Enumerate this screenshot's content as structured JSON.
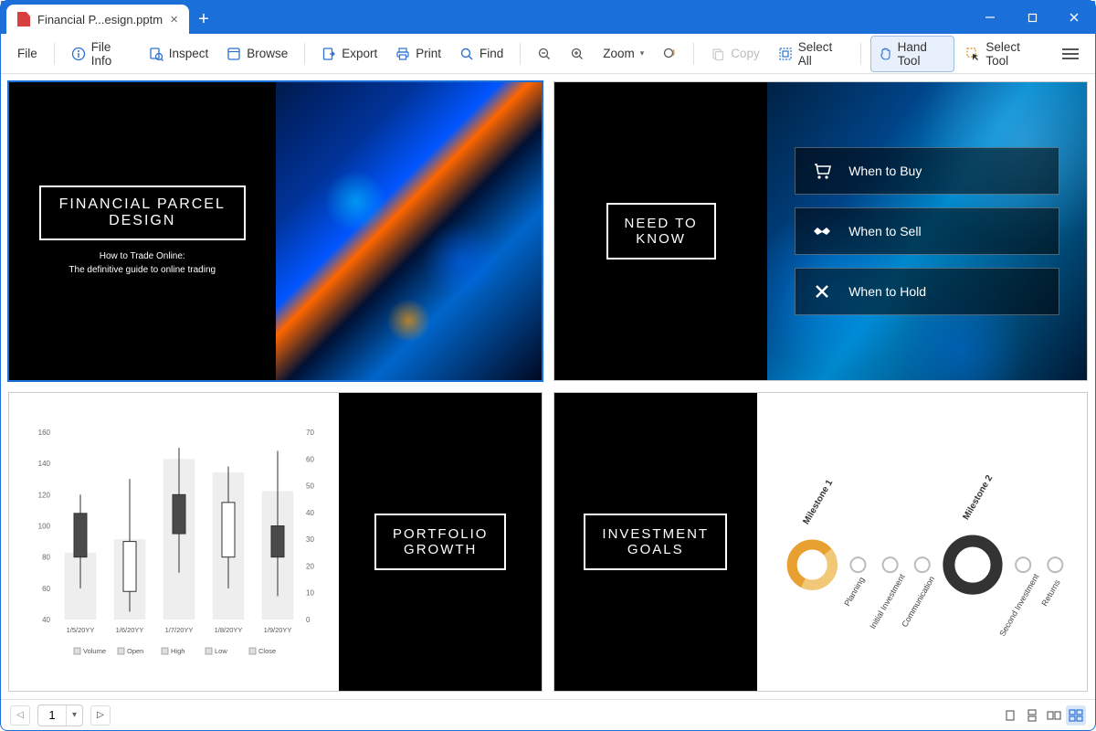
{
  "tab": {
    "title": "Financial P...esign.pptm"
  },
  "toolbar": {
    "file": "File",
    "fileinfo": "File Info",
    "inspect": "Inspect",
    "browse": "Browse",
    "export": "Export",
    "print": "Print",
    "find": "Find",
    "zoom": "Zoom",
    "copy": "Copy",
    "selectall": "Select All",
    "handtool": "Hand Tool",
    "selecttool": "Select Tool"
  },
  "slide1": {
    "title_l1": "FINANCIAL PARCEL",
    "title_l2": "DESIGN",
    "sub_l1": "How to Trade Online:",
    "sub_l2": "The definitive guide to online trading"
  },
  "slide2": {
    "title_l1": "NEED TO",
    "title_l2": "KNOW",
    "items": [
      {
        "label": "When to Buy"
      },
      {
        "label": "When to Sell"
      },
      {
        "label": "When to Hold"
      }
    ]
  },
  "slide3": {
    "title_l1": "PORTFOLIO",
    "title_l2": "GROWTH",
    "legend": [
      "Volume",
      "Open",
      "High",
      "Low",
      "Close"
    ]
  },
  "slide4": {
    "title_l1": "INVESTMENT",
    "title_l2": "GOALS",
    "milestones": [
      "Milestone 1",
      "Milestone 2"
    ],
    "steps": [
      "Planning",
      "Initial Investment",
      "Communication",
      "Second Investment",
      "Returns"
    ]
  },
  "status": {
    "page": "1"
  },
  "chart_data": {
    "type": "candlestick-with-volume",
    "title": "",
    "categories": [
      "1/5/20YY",
      "1/6/20YY",
      "1/7/20YY",
      "1/8/20YY",
      "1/9/20YY"
    ],
    "y_left": {
      "label": "",
      "range": [
        40,
        160
      ],
      "ticks": [
        40,
        60,
        80,
        100,
        120,
        140,
        160
      ]
    },
    "y_right": {
      "label": "",
      "range": [
        0,
        70
      ],
      "ticks": [
        0,
        10,
        20,
        30,
        40,
        50,
        60,
        70
      ]
    },
    "series": {
      "volume": [
        25,
        30,
        60,
        55,
        48
      ],
      "ohlc": [
        {
          "open": 80,
          "high": 120,
          "low": 60,
          "close": 108
        },
        {
          "open": 58,
          "high": 130,
          "low": 45,
          "close": 90
        },
        {
          "open": 95,
          "high": 150,
          "low": 70,
          "close": 120
        },
        {
          "open": 80,
          "high": 138,
          "low": 60,
          "close": 115
        },
        {
          "open": 80,
          "high": 148,
          "low": 55,
          "close": 100
        }
      ]
    },
    "legend": [
      "Volume",
      "Open",
      "High",
      "Low",
      "Close"
    ]
  }
}
